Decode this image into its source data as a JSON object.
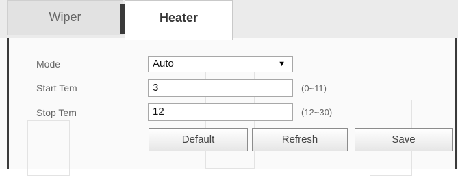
{
  "tabs": {
    "wiper": "Wiper",
    "heater": "Heater",
    "active": "Heater"
  },
  "form": {
    "mode": {
      "label": "Mode",
      "value": "Auto",
      "arrow": "▼"
    },
    "start_tem": {
      "label": "Start Tem",
      "value": "3",
      "range": "(0~11)"
    },
    "stop_tem": {
      "label": "Stop Tem",
      "value": "12",
      "range": "(12~30)"
    }
  },
  "buttons": {
    "default": "Default",
    "refresh": "Refresh",
    "save": "Save"
  },
  "colors": {
    "tabbar_bg": "#ebebeb",
    "panel_bg": "#fafafa",
    "border_dark": "#3a3a3a",
    "label_text": "#666666"
  }
}
